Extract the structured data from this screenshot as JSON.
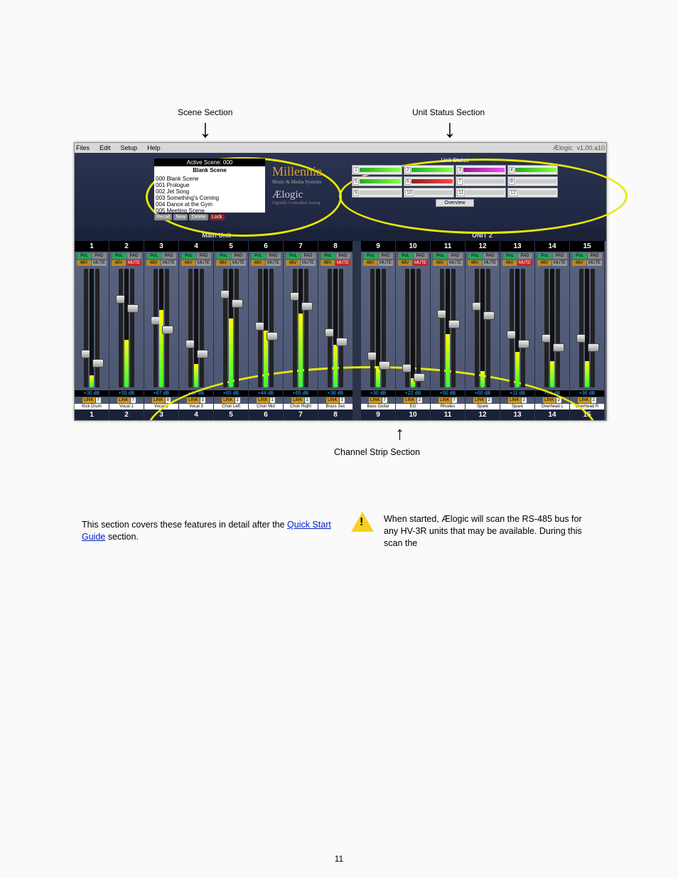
{
  "menubar": {
    "files": "Files",
    "edit": "Edit",
    "setup": "Setup",
    "help": "Help",
    "logo": "Ælogic",
    "version": "v1.00.a10"
  },
  "scene": {
    "header": "Active Scene: 000",
    "title": "Blank Scene",
    "list": [
      "000 Blank Scene",
      "001 Prologue",
      "002 Jet Song",
      "003 Something's Coming",
      "004 Dance at the Gym",
      "005 Meeting Scene"
    ],
    "buttons": {
      "recall": "Recall",
      "new": "New",
      "delete": "Delete",
      "lock": "Lock"
    }
  },
  "brand": {
    "name": "Millennia",
    "sub": "Music & Media Systems",
    "product": "Ælogic",
    "tag": "Digitally Controlled Analog"
  },
  "unit_status": {
    "header": "Unit Status",
    "cells": [
      {
        "n": "1",
        "state": "g"
      },
      {
        "n": "2",
        "state": "g"
      },
      {
        "n": "3",
        "state": "p"
      },
      {
        "n": "4",
        "state": "g"
      },
      {
        "n": "5",
        "state": "g"
      },
      {
        "n": "6",
        "state": "r"
      },
      {
        "n": "7",
        "state": "off"
      },
      {
        "n": "8",
        "state": "off"
      },
      {
        "n": "9",
        "state": "off"
      },
      {
        "n": "10",
        "state": "off"
      },
      {
        "n": "11",
        "state": "off"
      },
      {
        "n": "12",
        "state": "off"
      }
    ],
    "overview": "Overview"
  },
  "unit_labels": {
    "left": "Main Unit",
    "right": "UNIT 2"
  },
  "btn_labels": {
    "pol": "PoL",
    "pad": "PAD",
    "v48": "48V",
    "mute": "MUTE",
    "link": "LINK"
  },
  "channels": [
    {
      "num": "1",
      "name": "Kick Drum",
      "db": "+30 dB",
      "fader": 68,
      "meter": 10,
      "mute": false,
      "link": "7"
    },
    {
      "num": "2",
      "name": "Vocal 1",
      "db": "+55 dB",
      "fader": 22,
      "meter": 40,
      "mute": true,
      "link": "7"
    },
    {
      "num": "3",
      "name": "Vocal 2",
      "db": "+67 dB",
      "fader": 40,
      "meter": 65,
      "mute": false,
      "link": "8"
    },
    {
      "num": "4",
      "name": "Vocal 3",
      "db": "+30 dB",
      "fader": 60,
      "meter": 20,
      "mute": false,
      "link": "1"
    },
    {
      "num": "5",
      "name": "Choir Left",
      "db": "+65 dB",
      "fader": 18,
      "meter": 58,
      "mute": false,
      "link": "1"
    },
    {
      "num": "6",
      "name": "Choir Mid",
      "db": "+44 dB",
      "fader": 45,
      "meter": 48,
      "mute": false,
      "link": "1"
    },
    {
      "num": "7",
      "name": "Choir Right",
      "db": "+65 dB",
      "fader": 20,
      "meter": 62,
      "mute": false,
      "link": "1"
    },
    {
      "num": "8",
      "name": "Brass Sec",
      "db": "+36 dB",
      "fader": 50,
      "meter": 36,
      "mute": true,
      "link": "1"
    },
    {
      "num": "9",
      "name": "Bass Guitar",
      "db": "+30 dB",
      "fader": 70,
      "meter": 18,
      "mute": false,
      "link": "7"
    },
    {
      "num": "10",
      "name": "EG",
      "db": "+22 dB",
      "fader": 80,
      "meter": 8,
      "mute": true,
      "link": "2"
    },
    {
      "num": "11",
      "name": "Rhodes",
      "db": "+50 dB",
      "fader": 35,
      "meter": 45,
      "mute": false,
      "link": "7"
    },
    {
      "num": "12",
      "name": "Spare",
      "db": "+60 dB",
      "fader": 28,
      "meter": 14,
      "mute": false,
      "link": "2"
    },
    {
      "num": "13",
      "name": "Spare",
      "db": "+11 dB",
      "fader": 52,
      "meter": 30,
      "mute": true,
      "link": "2"
    },
    {
      "num": "14",
      "name": "Overhead L",
      "db": "+36 dB",
      "fader": 55,
      "meter": 22,
      "mute": false,
      "link": "2"
    },
    {
      "num": "15",
      "name": "Overhead R",
      "db": "+36 dB",
      "fader": 55,
      "meter": 22,
      "mute": false,
      "link": "2"
    }
  ],
  "doc": {
    "channel_strip_label": "Channel Strip Section",
    "unit_status_label": "Unit Status Section",
    "scene_label": "Scene Section",
    "intro": "This section covers these features in detail after the ",
    "link": "Quick Start Guide",
    "after_link": " section.",
    "scan": "When started, Ælogic will scan the RS-485 bus for any HV-3R units that may be available. During this scan the",
    "p11": "11"
  }
}
